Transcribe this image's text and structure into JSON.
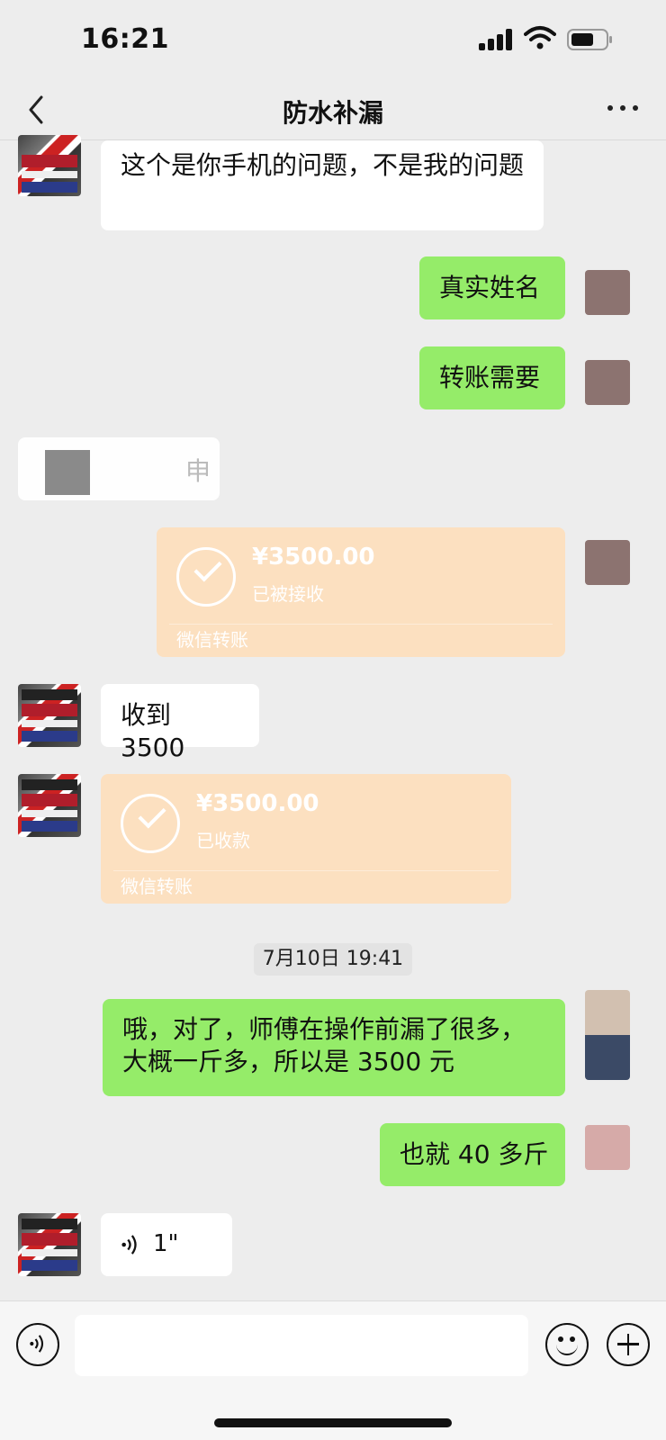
{
  "status": {
    "time": "16:21"
  },
  "nav": {
    "title": "防水补漏"
  },
  "messages": {
    "m1": {
      "text": "这个是你手机的问题，不是我的问题"
    },
    "m2": {
      "text": "真实姓名"
    },
    "m3": {
      "text": "转账需要"
    },
    "m4": {
      "text": "申"
    },
    "t1": {
      "amount": "¥3500.00",
      "status": "已被接收",
      "footer": "微信转账"
    },
    "m5": {
      "text": "收到 3500"
    },
    "t2": {
      "amount": "¥3500.00",
      "status": "已收款",
      "footer": "微信转账"
    },
    "timestamp": "7月10日 19:41",
    "m6": {
      "text": "哦，对了，师傅在操作前漏了很多，大概一斤多，所以是 3500 元"
    },
    "m7": {
      "text": "也就 40 多斤"
    },
    "m8": {
      "duration": "1\""
    }
  },
  "colors": {
    "background": "#ededed",
    "sent_bubble": "#95ec69",
    "received_bubble": "#ffffff",
    "transfer_card": "#fce0c0"
  },
  "icons": {
    "back": "chevron-left-icon",
    "more": "more-dots-icon",
    "voice_toggle": "voice-icon",
    "emoji": "emoji-icon",
    "plus": "plus-icon",
    "check": "check-circle-icon"
  }
}
